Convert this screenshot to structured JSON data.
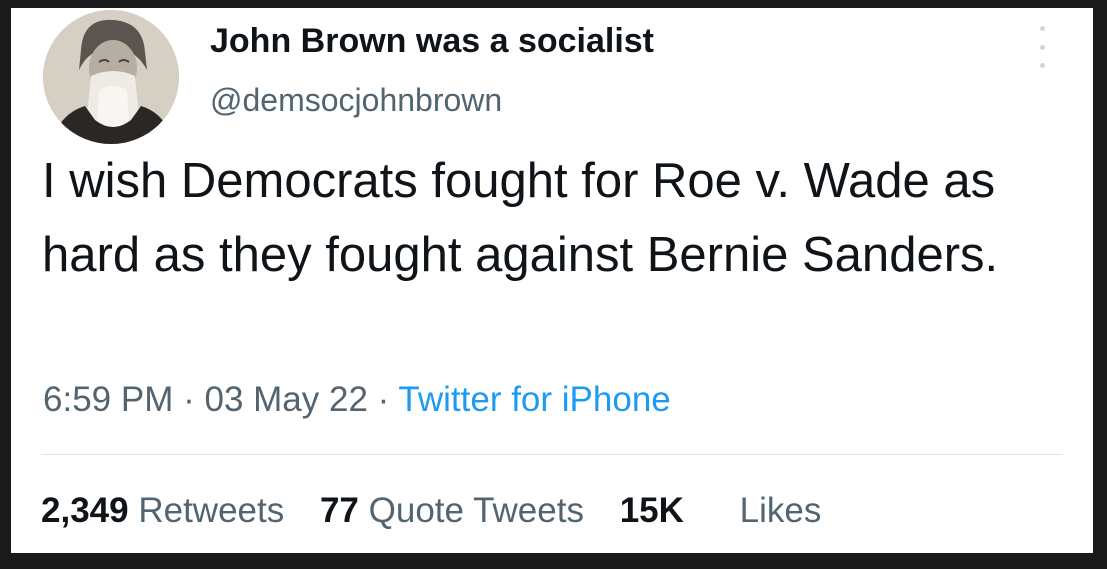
{
  "author": {
    "display_name": "John Brown was a socialist",
    "handle": "@demsocjohnbrown",
    "avatar_icon": "bearded-man-portrait-icon"
  },
  "tweet": {
    "text": "I wish Democrats fought for Roe v. Wade as hard as they fought against Bernie Sanders."
  },
  "meta": {
    "time": "6:59 PM",
    "separator": "·",
    "date": "03 May 22",
    "source": "Twitter for iPhone"
  },
  "stats": {
    "retweets_count": "2,349",
    "retweets_label": "Retweets",
    "quotes_count": "77",
    "quotes_label": "Quote Tweets",
    "likes_count": "15K",
    "likes_label": "Likes"
  },
  "colors": {
    "text": "#0f1419",
    "secondary": "#536471",
    "link": "#1d9bf0"
  }
}
